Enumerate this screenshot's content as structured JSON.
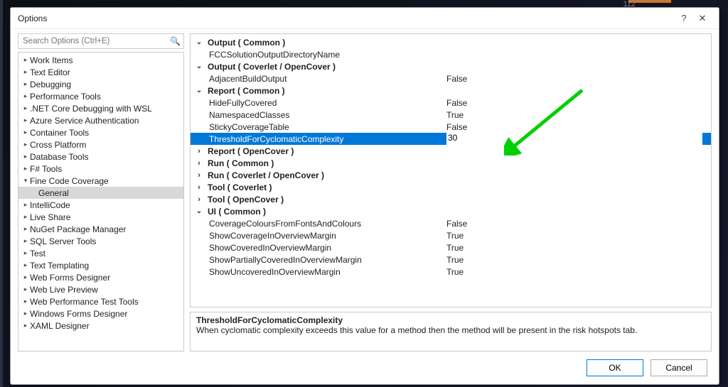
{
  "dialog": {
    "title": "Options",
    "help_btn": "?",
    "close_btn": "✕"
  },
  "search": {
    "placeholder": "Search Options (Ctrl+E)"
  },
  "tree": [
    {
      "label": "Work Items",
      "state": "collapsed"
    },
    {
      "label": "Text Editor",
      "state": "collapsed"
    },
    {
      "label": "Debugging",
      "state": "collapsed"
    },
    {
      "label": "Performance Tools",
      "state": "collapsed"
    },
    {
      "label": ".NET Core Debugging with WSL",
      "state": "collapsed"
    },
    {
      "label": "Azure Service Authentication",
      "state": "collapsed"
    },
    {
      "label": "Container Tools",
      "state": "collapsed"
    },
    {
      "label": "Cross Platform",
      "state": "collapsed"
    },
    {
      "label": "Database Tools",
      "state": "collapsed"
    },
    {
      "label": "F# Tools",
      "state": "collapsed"
    },
    {
      "label": "Fine Code Coverage",
      "state": "expanded",
      "children": [
        {
          "label": "General",
          "selected": true
        }
      ]
    },
    {
      "label": "IntelliCode",
      "state": "collapsed"
    },
    {
      "label": "Live Share",
      "state": "collapsed"
    },
    {
      "label": "NuGet Package Manager",
      "state": "collapsed"
    },
    {
      "label": "SQL Server Tools",
      "state": "collapsed"
    },
    {
      "label": "Test",
      "state": "collapsed"
    },
    {
      "label": "Text Templating",
      "state": "collapsed"
    },
    {
      "label": "Web Forms Designer",
      "state": "collapsed"
    },
    {
      "label": "Web Live Preview",
      "state": "collapsed"
    },
    {
      "label": "Web Performance Test Tools",
      "state": "collapsed"
    },
    {
      "label": "Windows Forms Designer",
      "state": "collapsed"
    },
    {
      "label": "XAML Designer",
      "state": "collapsed"
    }
  ],
  "grid": [
    {
      "type": "group",
      "label": "Output ( Common )",
      "state": "exp"
    },
    {
      "type": "prop",
      "key": "FCCSolutionOutputDirectoryName",
      "val": ""
    },
    {
      "type": "group",
      "label": "Output ( Coverlet / OpenCover )",
      "state": "exp"
    },
    {
      "type": "prop",
      "key": "AdjacentBuildOutput",
      "val": "False",
      "bold": true
    },
    {
      "type": "group",
      "label": "Report ( Common )",
      "state": "exp"
    },
    {
      "type": "prop",
      "key": "HideFullyCovered",
      "val": "False",
      "bold": true
    },
    {
      "type": "prop",
      "key": "NamespacedClasses",
      "val": "True",
      "bold": true
    },
    {
      "type": "prop",
      "key": "StickyCoverageTable",
      "val": "False",
      "bold": true
    },
    {
      "type": "prop",
      "key": "ThresholdForCyclomaticComplexity",
      "val": "30",
      "selected": true
    },
    {
      "type": "group",
      "label": "Report ( OpenCover )",
      "state": "col"
    },
    {
      "type": "group",
      "label": "Run ( Common )",
      "state": "col"
    },
    {
      "type": "group",
      "label": "Run ( Coverlet / OpenCover )",
      "state": "col"
    },
    {
      "type": "group",
      "label": "Tool ( Coverlet )",
      "state": "col"
    },
    {
      "type": "group",
      "label": "Tool ( OpenCover )",
      "state": "col"
    },
    {
      "type": "group",
      "label": "UI ( Common )",
      "state": "exp"
    },
    {
      "type": "prop",
      "key": "CoverageColoursFromFontsAndColours",
      "val": "False",
      "bold": true
    },
    {
      "type": "prop",
      "key": "ShowCoverageInOverviewMargin",
      "val": "True",
      "bold": true
    },
    {
      "type": "prop",
      "key": "ShowCoveredInOverviewMargin",
      "val": "True",
      "bold": true
    },
    {
      "type": "prop",
      "key": "ShowPartiallyCoveredInOverviewMargin",
      "val": "True",
      "bold": true
    },
    {
      "type": "prop",
      "key": "ShowUncoveredInOverviewMargin",
      "val": "True",
      "bold": true
    }
  ],
  "desc": {
    "title": "ThresholdForCyclomaticComplexity",
    "body": "When cyclomatic complexity exceeds this value for a method then the method will be present in the risk hotspots tab."
  },
  "footer": {
    "ok": "OK",
    "cancel": "Cancel"
  }
}
